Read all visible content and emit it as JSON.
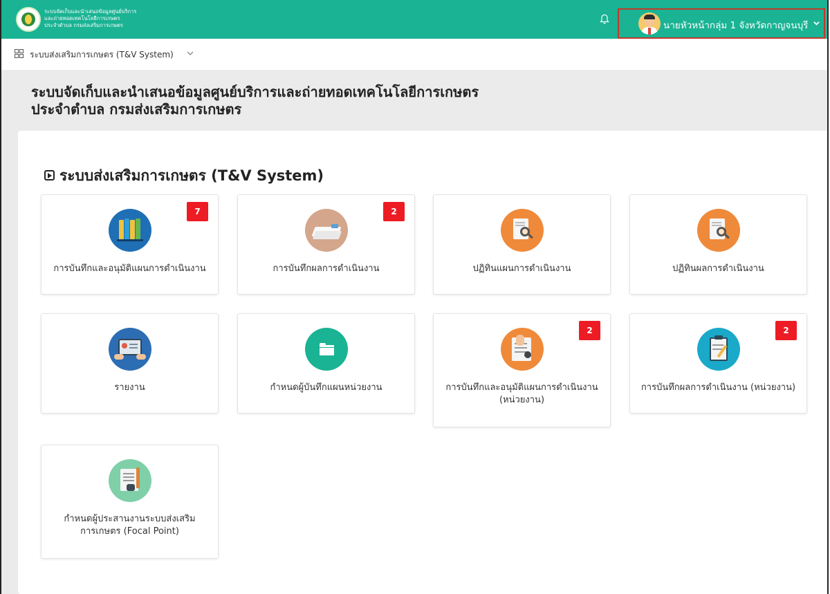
{
  "topbar": {
    "brand_line1": "ระบบจัดเก็บและนำเสนอข้อมูลศูนย์บริการ",
    "brand_line2": "และถ่ายทอดเทคโนโลยีการเกษตร",
    "brand_line3": "ประจำตำบล กรมส่งเสริมการเกษตร",
    "user_name": "นายหัวหน้ากลุ่ม 1 จังหวัดกาญจนบุรี",
    "icons": [
      "logo",
      "bell-icon",
      "avatar",
      "chevron-down-icon"
    ],
    "color": "#1ab394"
  },
  "subbar": {
    "system_label": "ระบบส่งเสริมการเกษตร (T&V System)"
  },
  "page": {
    "title_line1": "ระบบจัดเก็บและนำเสนอข้อมูลศูนย์บริการและถ่ายทอดเทคโนโลยีการเกษตร",
    "title_line2": "ประจำตำบล กรมส่งเสริมการเกษตร",
    "section_title": "ระบบส่งเสริมการเกษตร (T&V System)"
  },
  "cards": [
    {
      "label": "การบันทึกและอนุมัติแผนการดำเนินงาน",
      "badge": "7",
      "icon": "binders-icon",
      "color": "#1f6fb5"
    },
    {
      "label": "การบันทึกผลการดำเนินงาน",
      "badge": "2",
      "icon": "papers-icon",
      "color": "#d4a68c"
    },
    {
      "label": "ปฏิทินแผนการดำเนินงาน",
      "badge": "",
      "icon": "document-search-icon",
      "color": "#ef8a3b"
    },
    {
      "label": "ปฏิทินผลการดำเนินงาน",
      "badge": "",
      "icon": "document-search-icon",
      "color": "#ef8a3b"
    },
    {
      "label": "รายงาน",
      "badge": "",
      "icon": "tablet-report-icon",
      "color": "#2d6db3"
    },
    {
      "label": "กำหนดผู้บันทึกแผนหน่วยงาน",
      "badge": "",
      "icon": "folder-icon",
      "color": "#1ab394"
    },
    {
      "label": "การบันทึกและอนุมัติแผนการดำเนินงาน (หน่วยงาน)",
      "badge": "2",
      "icon": "checklist-icon",
      "color": "#ef8a3b"
    },
    {
      "label": "การบันทึกผลการดำเนินงาน (หน่วยงาน)",
      "badge": "2",
      "icon": "clipboard-icon",
      "color": "#1aa9c9"
    },
    {
      "label": "กำหนดผู้ประสานงานระบบส่งเสริม การเกษตร (Focal Point)",
      "badge": "",
      "icon": "notes-icon",
      "color": "#7fd0a9"
    }
  ]
}
